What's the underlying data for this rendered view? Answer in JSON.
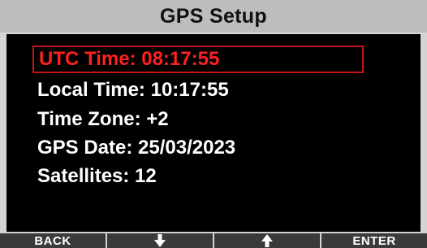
{
  "title": "GPS Setup",
  "menu": {
    "items": [
      {
        "label": "UTC Time: 08:17:55",
        "selected": true
      },
      {
        "label": "Local Time: 10:17:55",
        "selected": false
      },
      {
        "label": "Time Zone: +2",
        "selected": false
      },
      {
        "label": "GPS Date: 25/03/2023",
        "selected": false
      },
      {
        "label": "Satellites: 12",
        "selected": false
      }
    ]
  },
  "softkeys": {
    "back_label": "BACK",
    "down_icon": "arrow-down-icon",
    "up_icon": "arrow-up-icon",
    "enter_label": "ENTER"
  },
  "colors": {
    "selected_text": "#ff2020",
    "selected_border": "#c41414",
    "text": "#ffffff",
    "title_bar": "#bdbdbd"
  }
}
